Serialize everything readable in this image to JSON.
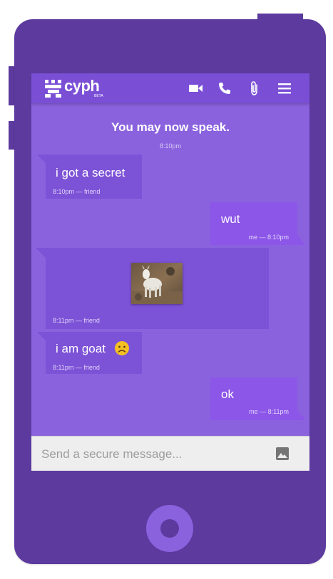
{
  "app": {
    "logo_text": "cyph",
    "beta_label": "BETA"
  },
  "toolbar": {
    "icons": [
      "video-icon",
      "phone-icon",
      "attachment-icon",
      "menu-icon"
    ]
  },
  "chat": {
    "status_title": "You may now speak.",
    "status_time": "8:10pm",
    "messages": [
      {
        "text": "i got a secret",
        "meta": "8:10pm  —  friend",
        "sender": "friend"
      },
      {
        "text": "wut",
        "meta": "me  —  8:10pm",
        "sender": "me"
      },
      {
        "text": "",
        "meta": "8:11pm  —  friend",
        "sender": "friend",
        "image": "goat-image"
      },
      {
        "text": "i am goat",
        "emoji": "🙁",
        "meta": "8:11pm  —  friend",
        "sender": "friend"
      },
      {
        "text": "ok",
        "meta": "me  —  8:11pm",
        "sender": "me"
      }
    ]
  },
  "composer": {
    "placeholder": "Send a secure message...",
    "icon": "image-icon"
  },
  "colors": {
    "device": "#5c3a9e",
    "screen": "#8a62de",
    "toolbar": "#7a4fd6",
    "bubble_friend": "#7c52d6",
    "bubble_me": "#8c56e8"
  }
}
